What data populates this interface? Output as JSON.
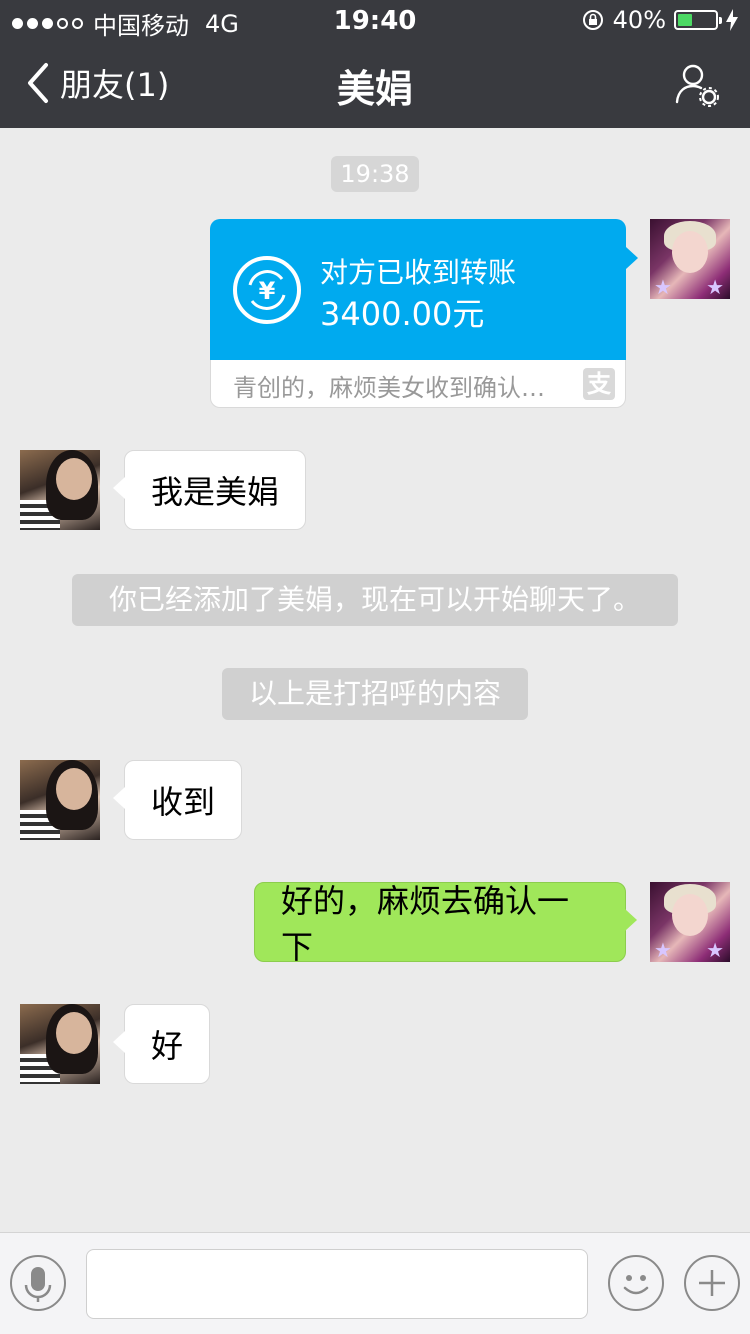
{
  "status_bar": {
    "carrier": "中国移动",
    "network": "4G",
    "time": "19:40",
    "battery": "40%",
    "battery_level": 0.4
  },
  "nav": {
    "back_label": "朋友(1)",
    "title": "美娟"
  },
  "chat": {
    "timestamp": "19:38",
    "transfer": {
      "status": "对方已收到转账",
      "amount": "3400.00元",
      "memo": "青创的，麻烦美女收到确认…",
      "alipay_glyph": "支"
    },
    "msg_1": "我是美娟",
    "system_added": "你已经添加了美娟，现在可以开始聊天了。",
    "system_greeting": "以上是打招呼的内容",
    "msg_2": "收到",
    "msg_3": "好的，麻烦去确认一下",
    "msg_4": "好"
  },
  "colors": {
    "nav_bg": "#393a3f",
    "chat_bg": "#ebebeb",
    "transfer_blue": "#00aaef",
    "sent_green": "#a0e75a"
  }
}
